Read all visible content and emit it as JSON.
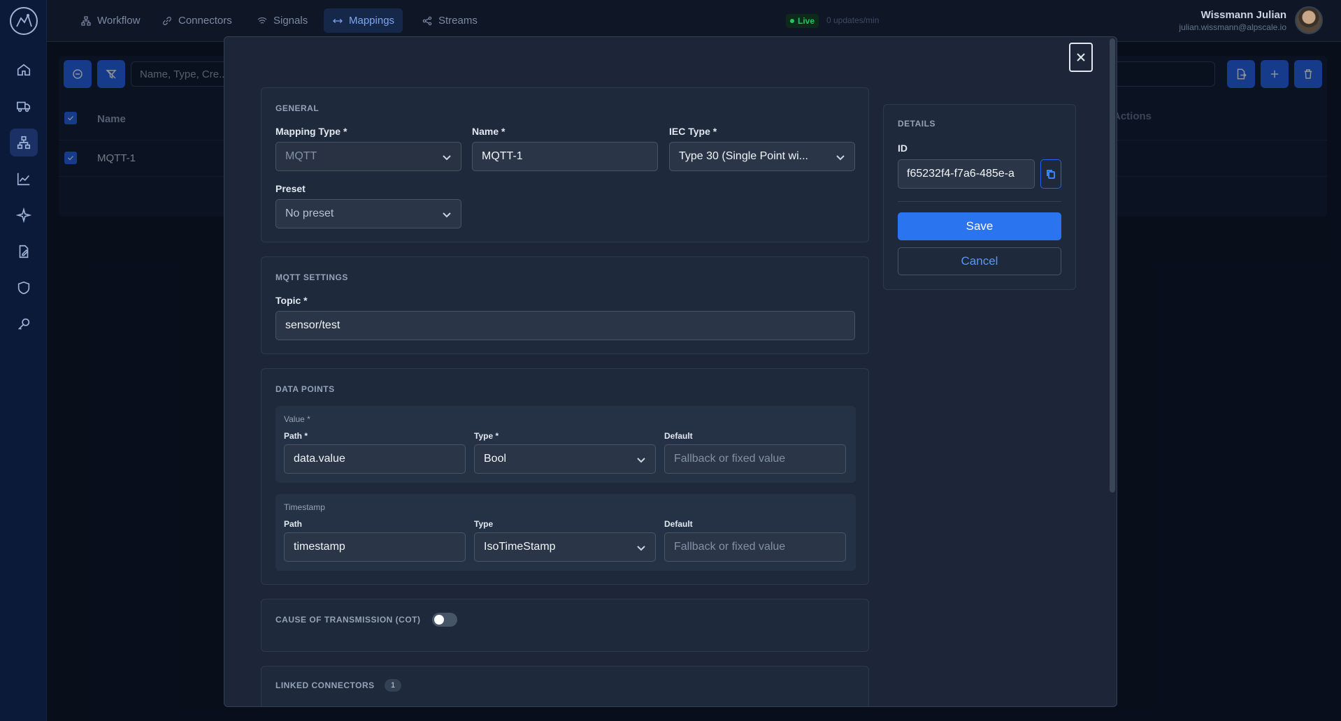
{
  "nav": {
    "tabs": [
      {
        "label": "Workflow",
        "icon": "workflow-icon"
      },
      {
        "label": "Connectors",
        "icon": "link-icon"
      },
      {
        "label": "Signals",
        "icon": "wifi-icon"
      },
      {
        "label": "Mappings",
        "icon": "arrows-horizontal-icon"
      },
      {
        "label": "Streams",
        "icon": "share-icon"
      }
    ],
    "active_tab": "Mappings",
    "live_label": "Live",
    "updates": "0 updates/min"
  },
  "user": {
    "name": "Wissmann Julian",
    "email": "julian.wissmann@alpscale.io"
  },
  "background_table": {
    "search_placeholder": "Name, Type, Cre...",
    "column_name": "Name",
    "column_actions": "Actions",
    "rows": [
      {
        "name": "MQTT-1"
      }
    ]
  },
  "modal": {
    "general": {
      "title": "GENERAL",
      "mapping_type_label": "Mapping Type *",
      "mapping_type_value": "MQTT",
      "name_label": "Name *",
      "name_value": "MQTT-1",
      "iec_type_label": "IEC Type *",
      "iec_type_value": "Type 30 (Single Point wi...",
      "preset_label": "Preset",
      "preset_value": "No preset"
    },
    "mqtt": {
      "title": "MQTT SETTINGS",
      "topic_label": "Topic *",
      "topic_value": "sensor/test"
    },
    "data_points": {
      "title": "DATA POINTS",
      "value_block": {
        "title": "Value *",
        "path_label": "Path *",
        "path_value": "data.value",
        "type_label": "Type *",
        "type_value": "Bool",
        "default_label": "Default",
        "default_placeholder": "Fallback or fixed value"
      },
      "timestamp_block": {
        "title": "Timestamp",
        "path_label": "Path",
        "path_value": "timestamp",
        "type_label": "Type",
        "type_value": "IsoTimeStamp",
        "default_label": "Default",
        "default_placeholder": "Fallback or fixed value"
      }
    },
    "cot": {
      "title": "CAUSE OF TRANSMISSION (COT)",
      "enabled": false
    },
    "linked": {
      "title": "LINKED CONNECTORS",
      "count": "1"
    },
    "details": {
      "title": "DETAILS",
      "id_label": "ID",
      "id_value": "f65232f4-f7a6-485e-a",
      "save_label": "Save",
      "cancel_label": "Cancel"
    }
  },
  "colors": {
    "accent": "#2b74f0",
    "live": "#22c55e",
    "modal_bg": "#1c2638"
  }
}
